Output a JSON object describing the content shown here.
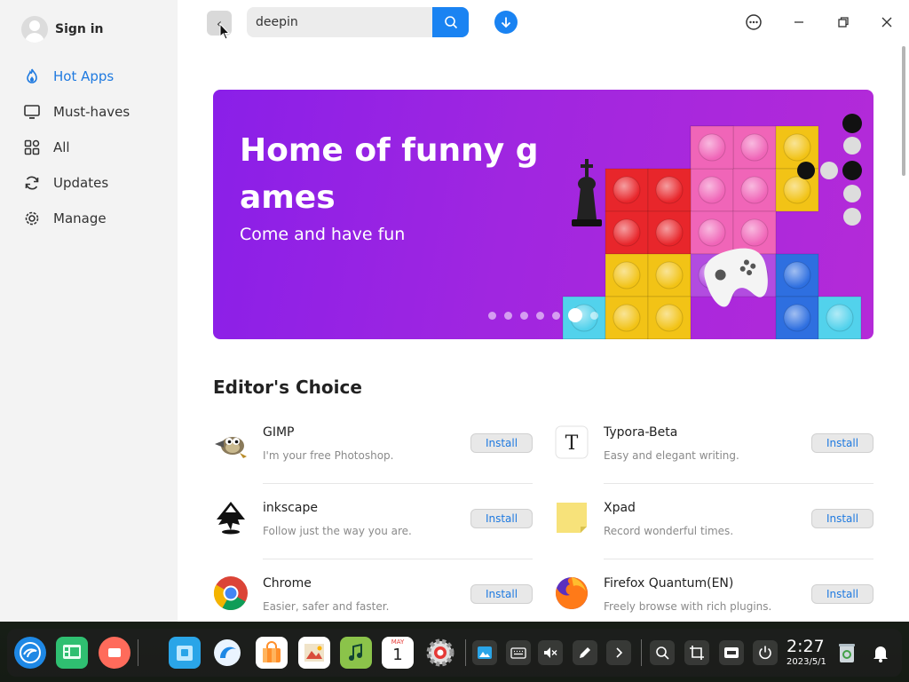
{
  "sidebar": {
    "signin_label": "Sign in",
    "items": [
      {
        "label": "Hot Apps",
        "icon": "fire-icon",
        "active": true
      },
      {
        "label": "Must-haves",
        "icon": "monitor-icon",
        "active": false
      },
      {
        "label": "All",
        "icon": "grid-icon",
        "active": false
      },
      {
        "label": "Updates",
        "icon": "refresh-icon",
        "active": false
      },
      {
        "label": "Manage",
        "icon": "gear-icon",
        "active": false
      }
    ]
  },
  "toolbar": {
    "search_value": "deepin"
  },
  "banner": {
    "title": "Home of funny games",
    "subtitle": "Come and have fun",
    "slide_count": 7,
    "active_slide": 6
  },
  "editors_choice": {
    "title": "Editor's Choice",
    "install_label": "Install",
    "apps": [
      {
        "name": "GIMP",
        "desc": "I'm your free Photoshop.",
        "icon": "gimp-icon"
      },
      {
        "name": "Typora-Beta",
        "desc": "Easy and elegant writing.",
        "icon": "typora-icon"
      },
      {
        "name": "inkscape",
        "desc": "Follow just the way you are.",
        "icon": "inkscape-icon"
      },
      {
        "name": "Xpad",
        "desc": "Record wonderful times.",
        "icon": "xpad-icon"
      },
      {
        "name": "Chrome",
        "desc": "Easier, safer and faster.",
        "icon": "chrome-icon"
      },
      {
        "name": "Firefox Quantum(EN)",
        "desc": "Freely browse with rich plugins.",
        "icon": "firefox-icon"
      }
    ]
  },
  "taskbar": {
    "time": "2:27",
    "date": "2023/5/1",
    "calendar_month": "MAY",
    "calendar_day": "1"
  },
  "colors": {
    "accent": "#1a83f2",
    "banner_start": "#8a1fe8",
    "banner_end": "#b42ad8"
  }
}
